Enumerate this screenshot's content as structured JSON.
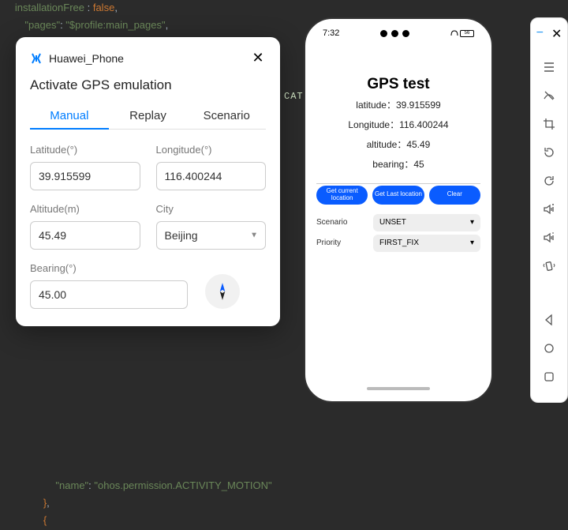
{
  "code": {
    "line1_key": "installationFree",
    "line1_val": "false",
    "line2_key": "\"pages\"",
    "line2_val": "\"$profile:main_pages\"",
    "cation": "CATI",
    "bottom_key": "\"name\"",
    "bottom_val": "\"ohos.permission.ACTIVITY_MOTION\""
  },
  "dialog": {
    "device": "Huawei_Phone",
    "heading": "Activate GPS emulation",
    "tabs": {
      "manual": "Manual",
      "replay": "Replay",
      "scenario": "Scenario"
    },
    "labels": {
      "latitude": "Latitude(°)",
      "longitude": "Longitude(°)",
      "altitude": "Altitude(m)",
      "city": "City",
      "bearing": "Bearing(°)"
    },
    "values": {
      "latitude": "39.915599",
      "longitude": "116.400244",
      "altitude": "45.49",
      "city": "Beijing",
      "bearing": "45.00"
    }
  },
  "phone": {
    "time": "7:32",
    "battery": "56",
    "title": "GPS test",
    "lat_line": "latitude：39.915599",
    "lon_line": "Longitude：116.400244",
    "alt_line": "altitude：45.49",
    "bearing_line": "bearing：45",
    "buttons": {
      "current": "Get current location",
      "last": "Get Last location",
      "clear": "Clear"
    },
    "scenario_label": "Scenario",
    "scenario_value": "UNSET",
    "priority_label": "Priority",
    "priority_value": "FIRST_FIX"
  },
  "toolbar": {
    "minimize": "−",
    "close": "✕"
  }
}
